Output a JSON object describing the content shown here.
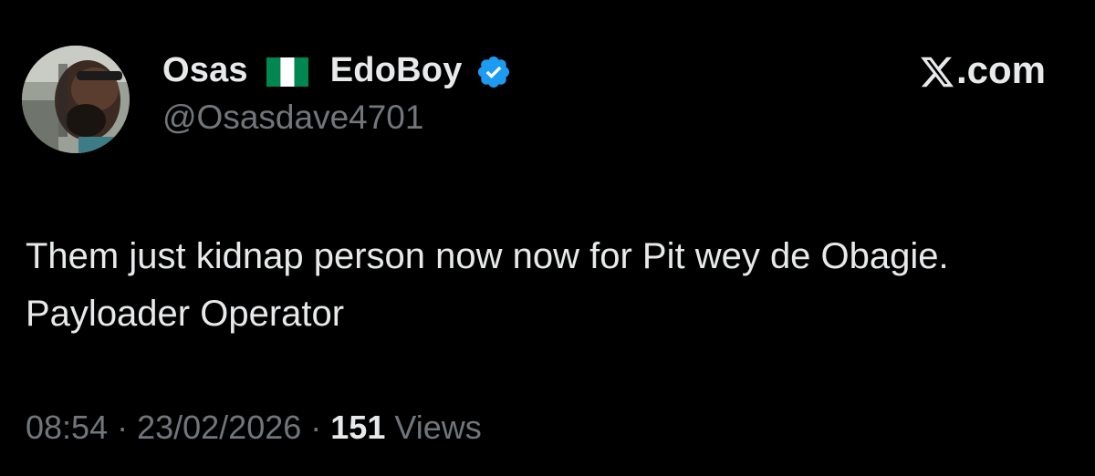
{
  "author": {
    "display_name_first": "Osas",
    "flag_icon": "nigeria-flag-icon",
    "display_name_second": "EdoBoy",
    "verified_icon": "verified-badge-icon",
    "handle": "@Osasdave4701",
    "avatar_icon": "profile-photo"
  },
  "brand": {
    "icon": "x-logo-icon",
    "label": ".com"
  },
  "tweet": {
    "text": "Them just kidnap person now now for Pit wey de Obagie. Payloader Operator"
  },
  "meta": {
    "time": "08:54",
    "separator_1": " · ",
    "date": "23/02/2026",
    "separator_2": " · ",
    "views_count": "151",
    "views_label": " Views"
  },
  "colors": {
    "background": "#000000",
    "primary_text": "#e7e9ea",
    "secondary_text": "#71767b",
    "verified_blue": "#1d9bf0",
    "flag_green": "#008751",
    "flag_white": "#ffffff"
  }
}
